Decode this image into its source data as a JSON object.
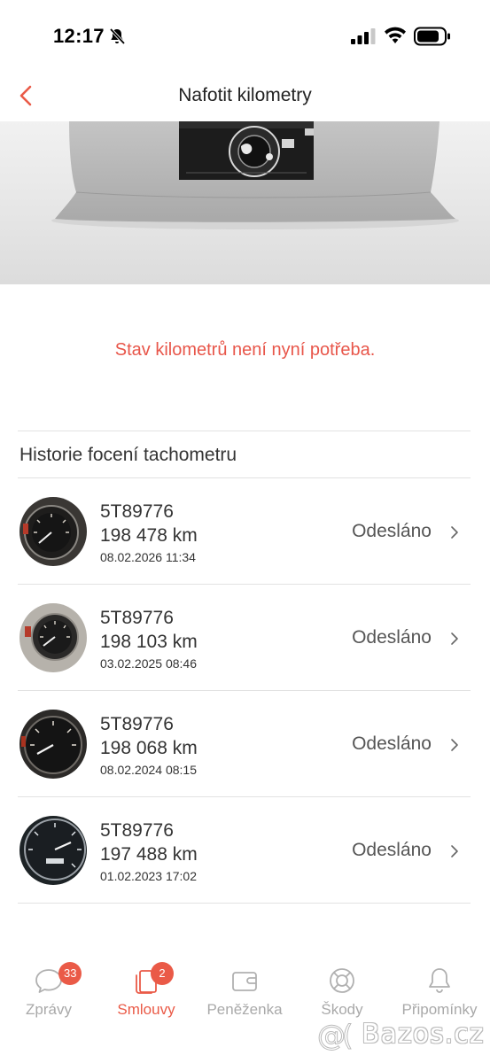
{
  "status_bar": {
    "time": "12:17"
  },
  "nav": {
    "title": "Nafotit kilometry"
  },
  "notice": {
    "text": "Stav kilometrů není nyní potřeba."
  },
  "history": {
    "title": "Historie focení tachometru",
    "items": [
      {
        "plate": "5T89776",
        "km": "198 478 km",
        "date": "08.02.2026 11:34",
        "status": "Odesláno"
      },
      {
        "plate": "5T89776",
        "km": "198 103 km",
        "date": "03.02.2025 08:46",
        "status": "Odesláno"
      },
      {
        "plate": "5T89776",
        "km": "198 068 km",
        "date": "08.02.2024 08:15",
        "status": "Odesláno"
      },
      {
        "plate": "5T89776",
        "km": "197 488 km",
        "date": "01.02.2023 17:02",
        "status": "Odesláno"
      }
    ]
  },
  "tabs": [
    {
      "label": "Zprávy",
      "icon": "chat-bubble-icon",
      "badge": "33",
      "active": false
    },
    {
      "label": "Smlouvy",
      "icon": "documents-icon",
      "badge": "2",
      "active": true
    },
    {
      "label": "Peněženka",
      "icon": "wallet-icon",
      "badge": "",
      "active": false
    },
    {
      "label": "Škody",
      "icon": "lifebuoy-icon",
      "badge": "",
      "active": false
    },
    {
      "label": "Připomínky",
      "icon": "bell-icon",
      "badge": "",
      "active": false
    }
  ],
  "watermark": {
    "text": "Bazos.cz"
  },
  "colors": {
    "accent": "#ea5a47",
    "notice": "#e8564a",
    "inactive": "#a9a9a9",
    "divider": "#e2e2e2"
  }
}
